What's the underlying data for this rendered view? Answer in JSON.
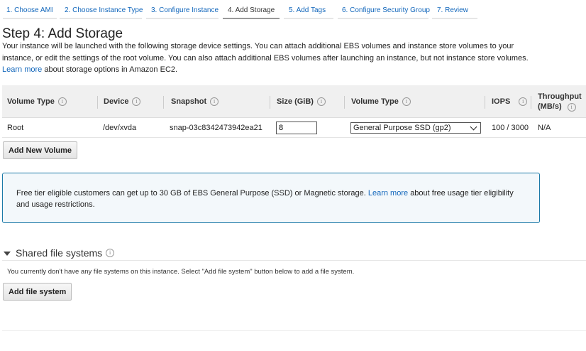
{
  "wizard": {
    "steps": [
      {
        "label": "1. Choose AMI"
      },
      {
        "label": "2. Choose Instance Type"
      },
      {
        "label": "3. Configure Instance"
      },
      {
        "label": "4. Add Storage"
      },
      {
        "label": "5. Add Tags"
      },
      {
        "label": "6. Configure Security Group"
      },
      {
        "label": "7. Review"
      }
    ],
    "active_step": "4. Add Storage"
  },
  "page": {
    "title": "Step 4: Add Storage",
    "description": "Your instance will be launched with the following storage device settings. You can attach additional EBS volumes and instance store volumes to your instance, or edit the settings of the root volume. You can also attach additional EBS volumes after launching an instance, but not instance store volumes.",
    "learn_more": "Learn more",
    "description_suffix": "about storage options in Amazon EC2."
  },
  "storage_table": {
    "headers": {
      "volume_type": "Volume Type",
      "device": "Device",
      "snapshot": "Snapshot",
      "size": "Size (GiB)",
      "ebs_type": "Volume Type",
      "iops": "IOPS",
      "throughput_line1": "Throughput",
      "throughput_line2": "(MB/s)"
    },
    "info_icon_glyph": "i",
    "rows": [
      {
        "volume_type": "Root",
        "device": "/dev/xvda",
        "snapshot": "snap-03c8342473942ea21",
        "size": "8",
        "ebs_type": "General Purpose SSD (gp2)",
        "iops": "100 / 3000",
        "throughput": "N/A"
      }
    ]
  },
  "buttons": {
    "add_volume": "Add New Volume",
    "add_file_system": "Add file system"
  },
  "notice": {
    "text": "Free tier eligible customers can get up to 30 GB of EBS General Purpose (SSD) or Magnetic storage.",
    "learn_more": "Learn more",
    "suffix": "about free usage tier eligibility and usage restrictions."
  },
  "shared_fs": {
    "title": "Shared file systems",
    "message": "You currently don't have any file systems on this instance. Select \"Add file system\" button below to add a file system."
  },
  "colors": {
    "link": "#1166bb",
    "notice_border": "#1c7aa8",
    "table_header_bg": "#f0f0f0"
  }
}
